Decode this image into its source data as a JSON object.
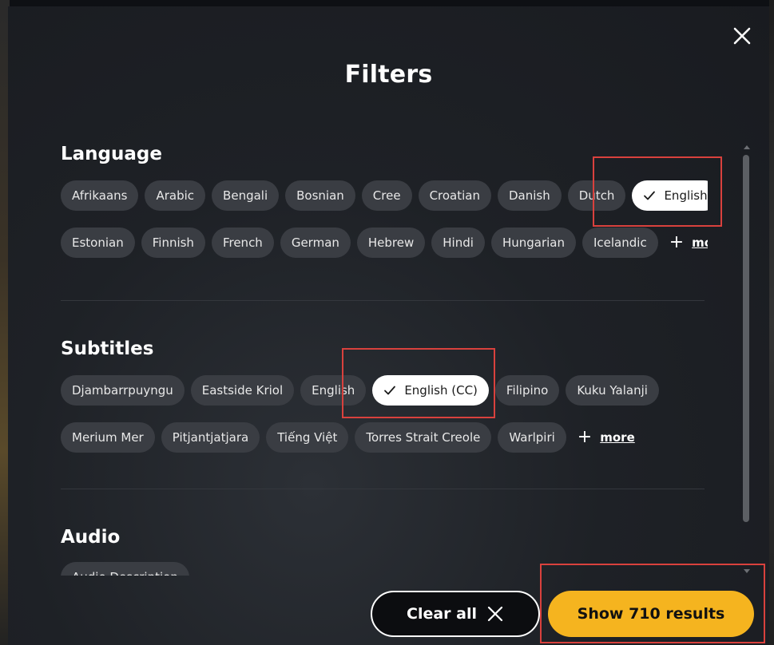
{
  "dialog": {
    "title": "Filters"
  },
  "language": {
    "title": "Language",
    "row1": [
      "Afrikaans",
      "Arabic",
      "Bengali",
      "Bosnian",
      "Cree",
      "Croatian",
      "Danish",
      "Dutch"
    ],
    "selected": "English",
    "row2": [
      "Estonian",
      "Finnish",
      "French",
      "German",
      "Hebrew",
      "Hindi",
      "Hungarian",
      "Icelandic"
    ],
    "more_label": "more"
  },
  "subtitles": {
    "title": "Subtitles",
    "row1_before": [
      "Djambarrpuyngu",
      "Eastside Kriol",
      "English"
    ],
    "selected": "English (CC)",
    "row1_after": [
      "Filipino",
      "Kuku Yalanji"
    ],
    "row2": [
      "Merium Mer",
      "Pitjantjatjara",
      "Tiếng Việt",
      "Torres Strait Creole",
      "Warlpiri"
    ],
    "more_label": "more"
  },
  "audio": {
    "title": "Audio",
    "options": [
      "Audio Description"
    ]
  },
  "footer": {
    "clear_label": "Clear all",
    "show_label": "Show 710 results"
  },
  "colors": {
    "accent": "#f5b41f",
    "chip_bg": "#3a3d43",
    "selected_chip_bg": "#ffffff",
    "annotation": "#d9413d"
  },
  "icons": {
    "close": "close-icon",
    "check": "check-icon",
    "plus": "plus-icon",
    "clear": "x-icon"
  }
}
